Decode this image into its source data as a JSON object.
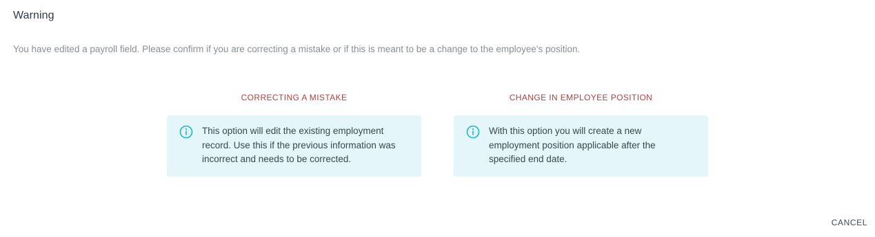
{
  "dialog": {
    "title": "Warning",
    "message": "You have edited a payroll field. Please confirm if you are correcting a mistake or if this is meant to be a change to the employee's position."
  },
  "options": [
    {
      "title": "CORRECTING A MISTAKE",
      "lines": [
        "This option will edit the existing employment",
        "record. Use this if the previous information was",
        "incorrect and needs to be corrected."
      ]
    },
    {
      "title": "CHANGE IN EMPLOYEE POSITION",
      "lines": [
        "With this option you will create a new",
        "employment position applicable after the",
        "specified end date."
      ]
    }
  ],
  "actions": {
    "cancel_label": "CANCEL"
  },
  "colors": {
    "option_title": "#b0413e",
    "info_background": "#e4f6f9",
    "info_icon": "#1fb6c8"
  },
  "icons": {
    "info": "info-circle-icon"
  }
}
